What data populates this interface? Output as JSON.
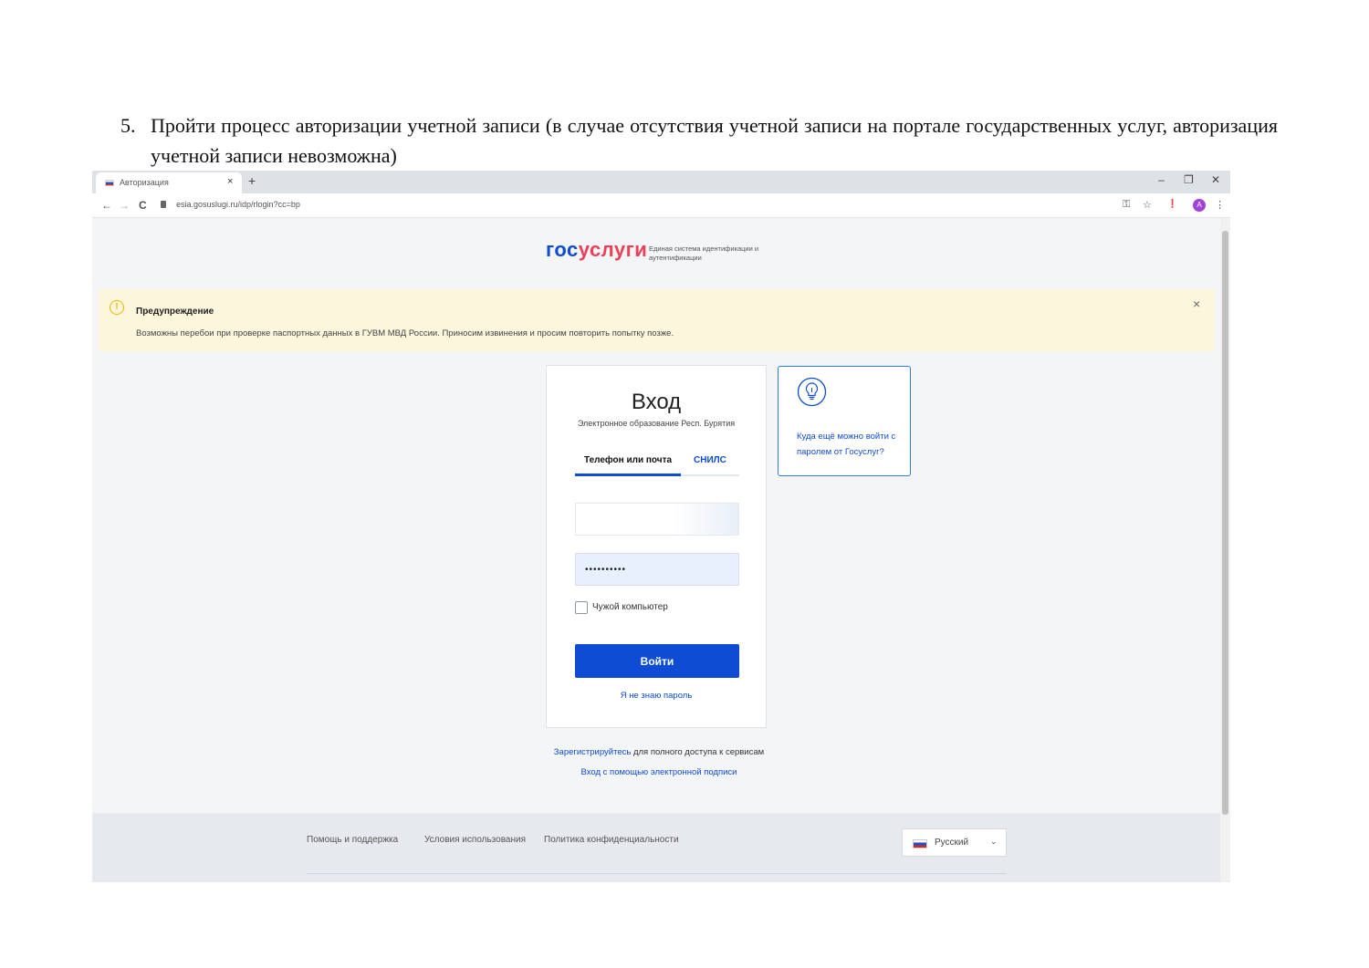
{
  "document": {
    "step_number": "5.",
    "step_text": "Пройти процесс авторизации учетной записи (в случае отсутствия учетной записи на портале государственных услуг, авторизация учетной записи невозможна)"
  },
  "browser": {
    "tab_title": "Авторизация",
    "tab_close": "×",
    "new_tab": "+",
    "window_controls": {
      "minimize": "–",
      "restore": "❐",
      "close": "✕"
    },
    "nav": {
      "back": "←",
      "forward": "→",
      "reload": "C"
    },
    "url": "esia.gosuslugi.ru/idp/rlogin?cc=bp",
    "toolbar_icons": {
      "key": "⚿",
      "star": "☆",
      "extension": "❗",
      "menu": "⋮"
    },
    "profile_initial": "A"
  },
  "header": {
    "logo_gos": "гос",
    "logo_uslugi": "услуги",
    "logo_subtitle": "Единая система идентификации и аутентификации"
  },
  "warning": {
    "icon": "!",
    "title": "Предупреждение",
    "text": "Возможны перебои при проверке паспортных данных в ГУВМ МВД России. Приносим извинения и просим повторить попытку позже.",
    "close": "×"
  },
  "login": {
    "title": "Вход",
    "organization": "Электронное образование Респ. Бурятия",
    "tabs": [
      "Телефон или почта",
      "СНИЛС"
    ],
    "login_value": "",
    "password_value": "••••••••••",
    "remember_label": "Чужой компьютер",
    "submit_label": "Войти",
    "forgot_label": "Я не знаю пароль"
  },
  "hint": {
    "text": "Куда ещё можно войти с паролем от Госуслуг?"
  },
  "below": {
    "register_link": "Зарегистрируйтесь",
    "register_rest": " для полного доступа к сервисам",
    "esignature_link": "Вход с помощью электронной подписи"
  },
  "footer": {
    "links": [
      "Помощь и поддержка",
      "Условия использования",
      "Политика конфиденциальности"
    ],
    "language": "Русский",
    "language_chevron": "⌄"
  },
  "colors": {
    "brand_blue": "#0d4cd3",
    "brand_red": "#ee3f58",
    "warning_bg": "#fcf6dc",
    "warning_icon": "#f4b400"
  }
}
